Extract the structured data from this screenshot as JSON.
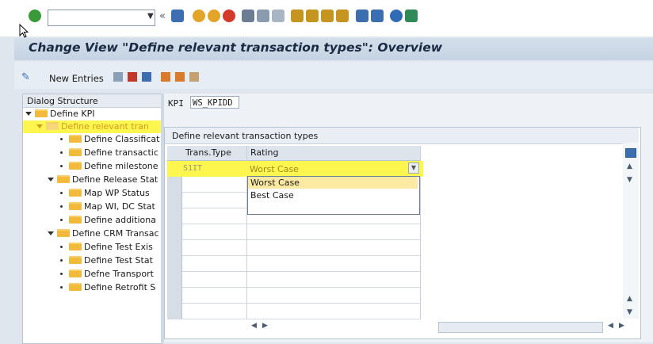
{
  "toolbar": {
    "command_value": "",
    "icons": [
      "enter-icon",
      "dropdown-icon",
      "back-history-icon",
      "save-icon",
      "back-icon",
      "exit-icon",
      "cancel-icon",
      "print-icon",
      "find-icon",
      "find-next-icon",
      "first-page-icon",
      "previous-page-icon",
      "next-page-icon",
      "last-page-icon",
      "create-session-icon",
      "shortcut-icon",
      "help-icon",
      "customize-layout-icon"
    ]
  },
  "title": "Change View \"Define relevant transaction types\": Overview",
  "app_toolbar": {
    "new_entries": "New Entries"
  },
  "dialog_structure": {
    "header": "Dialog Structure",
    "items": [
      {
        "label": "Define KPI"
      },
      {
        "label": "Define relevant tran"
      },
      {
        "label": "Define Classificat"
      },
      {
        "label": "Define transactic"
      },
      {
        "label": "Define milestone"
      },
      {
        "label": "Define Release Stat"
      },
      {
        "label": "Map WP Status"
      },
      {
        "label": "Map WI, DC Stat"
      },
      {
        "label": "Define additiona"
      },
      {
        "label": "Define CRM Transac"
      },
      {
        "label": "Define Test Exis"
      },
      {
        "label": "Define Test Stat"
      },
      {
        "label": "Defne Transport"
      },
      {
        "label": "Define Retrofit S"
      }
    ]
  },
  "kpi": {
    "label": "KPI",
    "value": "WS_KPIDD"
  },
  "table": {
    "title": "Define relevant transaction types",
    "columns": [
      "Trans.Type",
      "Rating"
    ],
    "rows": [
      {
        "trans_type": "S1IT",
        "rating": "Worst Case"
      }
    ]
  },
  "dropdown": {
    "options": [
      "Worst Case",
      "Best Case"
    ],
    "selected": "Worst Case"
  },
  "colors": {
    "highlight": "#fcf64f",
    "title_bar": "#c5d3e2",
    "folder": "#f3b93a"
  }
}
